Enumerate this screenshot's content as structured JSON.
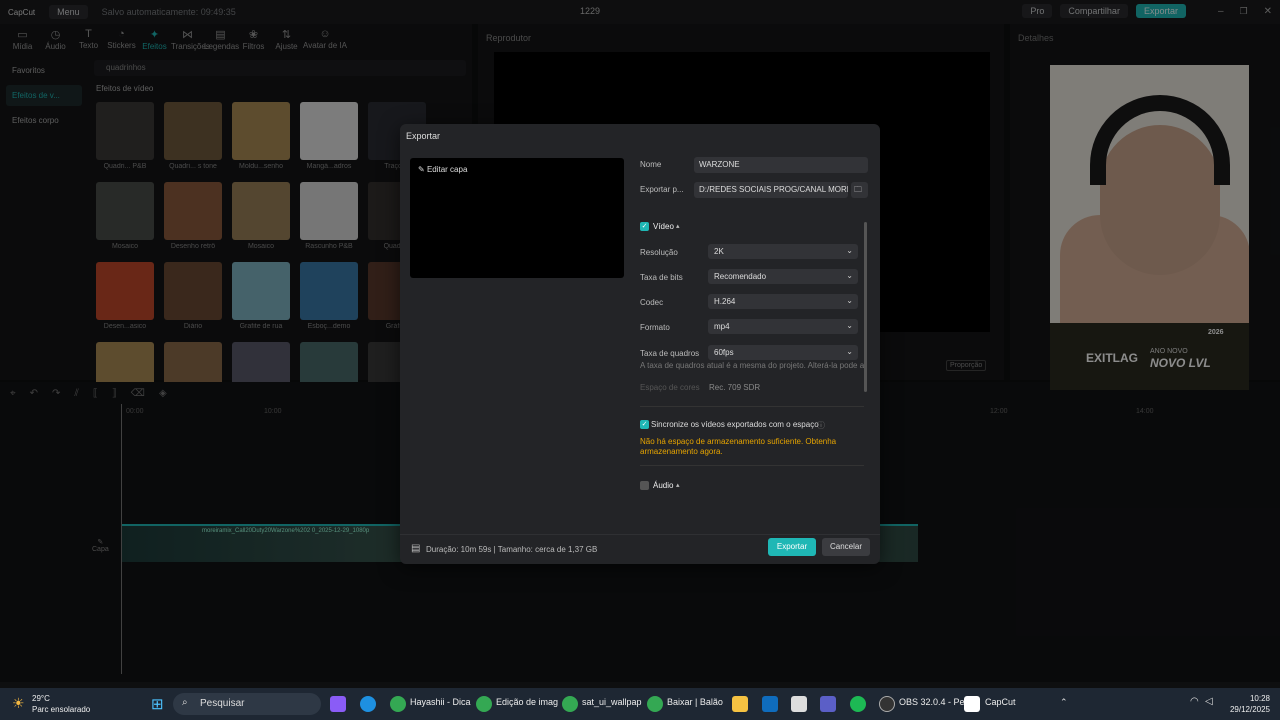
{
  "titlebar": {
    "app": "CapCut",
    "menu": "Menu",
    "saved": "Salvo automaticamente: 09:49:35",
    "project": "1229",
    "pro": "Pro",
    "share": "Compartilhar",
    "export": "Exportar"
  },
  "toolbar": [
    {
      "label": "Mídia",
      "icon": "media-icon"
    },
    {
      "label": "Áudio",
      "icon": "audio-icon"
    },
    {
      "label": "Texto",
      "icon": "text-icon"
    },
    {
      "label": "Stickers",
      "icon": "sticker-icon"
    },
    {
      "label": "Efeitos",
      "icon": "effects-icon"
    },
    {
      "label": "Transições",
      "icon": "transition-icon"
    },
    {
      "label": "Legendas",
      "icon": "captions-icon"
    },
    {
      "label": "Filtros",
      "icon": "filter-icon"
    },
    {
      "label": "Ajuste",
      "icon": "adjust-icon"
    },
    {
      "label": "Avatar de IA",
      "icon": "avatar-icon"
    }
  ],
  "sidebar": [
    "Favoritos",
    "Efeitos de v...",
    "Efeitos corpo"
  ],
  "search": {
    "value": "quadrinhos"
  },
  "effects_title": "Efeitos de vídeo",
  "effects": [
    {
      "name": "Quadri... P&B",
      "color": "#3b3a38"
    },
    {
      "name": "Quadri... s tone",
      "color": "#6f5a3c"
    },
    {
      "name": "Moldu...senho",
      "color": "#a98a55"
    },
    {
      "name": "Mangá...adros",
      "color": "#e2e2e2"
    },
    {
      "name": "Traço ...",
      "color": "#2a2d33"
    },
    {
      "name": "Mosaico",
      "color": "#4a4e4a"
    },
    {
      "name": "Desenho retrô",
      "color": "#8a5a3c"
    },
    {
      "name": "Mosaico",
      "color": "#9a8058"
    },
    {
      "name": "Rascunho P&B",
      "color": "#d8d8d8"
    },
    {
      "name": "Quadri...",
      "color": "#33302e"
    },
    {
      "name": "Desen...asico",
      "color": "#c0472b"
    },
    {
      "name": "Diário",
      "color": "#6a4a34"
    },
    {
      "name": "Grafite de rua",
      "color": "#7fb3c2"
    },
    {
      "name": "Esboç...demo",
      "color": "#3a78a8"
    },
    {
      "name": "Gráfico",
      "color": "#5a3a2c"
    },
    {
      "name": "",
      "color": "#a98a55"
    },
    {
      "name": "",
      "color": "#8a6a4a"
    },
    {
      "name": "",
      "color": "#5a5a6a"
    },
    {
      "name": "",
      "color": "#4a6a6a"
    },
    {
      "name": "",
      "color": "#3a3a3a"
    }
  ],
  "player": {
    "title": "Reprodutor",
    "ratio": "Proporção"
  },
  "details": {
    "title": "Detalhes"
  },
  "webcam_banner": {
    "brand": "EXITLAG",
    "tagline": "ANO NOVO",
    "slogan": "NOVO LVL",
    "year": "2026"
  },
  "timeline": {
    "marks": [
      "00:00",
      "10:00",
      "12:00",
      "14:00"
    ],
    "clip_label": "moreiramix_Call20Duty20Warzone%202 0_2025-12-29_1080p",
    "cover": "Capa"
  },
  "dialog": {
    "title": "Exportar",
    "edit_cover": "Editar capa",
    "name_label": "Nome",
    "name_value": "WARZONE",
    "path_label": "Exportar p...",
    "path_value": "D:/REDES SOCIAIS PROG/CANAL MOREI...",
    "video_label": "Vídeo",
    "resolution_label": "Resolução",
    "resolution_value": "2K",
    "bitrate_label": "Taxa de bits",
    "bitrate_value": "Recomendado",
    "codec_label": "Codec",
    "codec_value": "H.264",
    "format_label": "Formato",
    "format_value": "mp4",
    "fps_label": "Taxa de quadros",
    "fps_value": "60fps",
    "fps_note": "A taxa de quadros atual é a mesma do projeto. Alterá-la pode af",
    "colorspace_label": "Espaço de cores",
    "colorspace_value": "Rec. 709 SDR",
    "sync_label": "Sincronize os vídeos exportados com o espaço",
    "storage_warning": "Não há espaço de armazenamento suficiente. Obtenha armazenamento agora.",
    "audio_label": "Áudio",
    "footer_info": "Duração: 10m 59s | Tamanho: cerca de 1,37 GB",
    "export_button": "Exportar",
    "cancel_button": "Cancelar"
  },
  "taskbar": {
    "temp": "29°C",
    "weather": "Parc ensolarado",
    "search": "Pesquisar",
    "apps": [
      "Hayashii - Dica",
      "Edição de imag",
      "sat_ui_wallpap",
      "Baixar | Balão",
      "OBS 32.0.4 - Pe",
      "CapCut"
    ],
    "time": "10:28",
    "date": "29/12/2025"
  }
}
